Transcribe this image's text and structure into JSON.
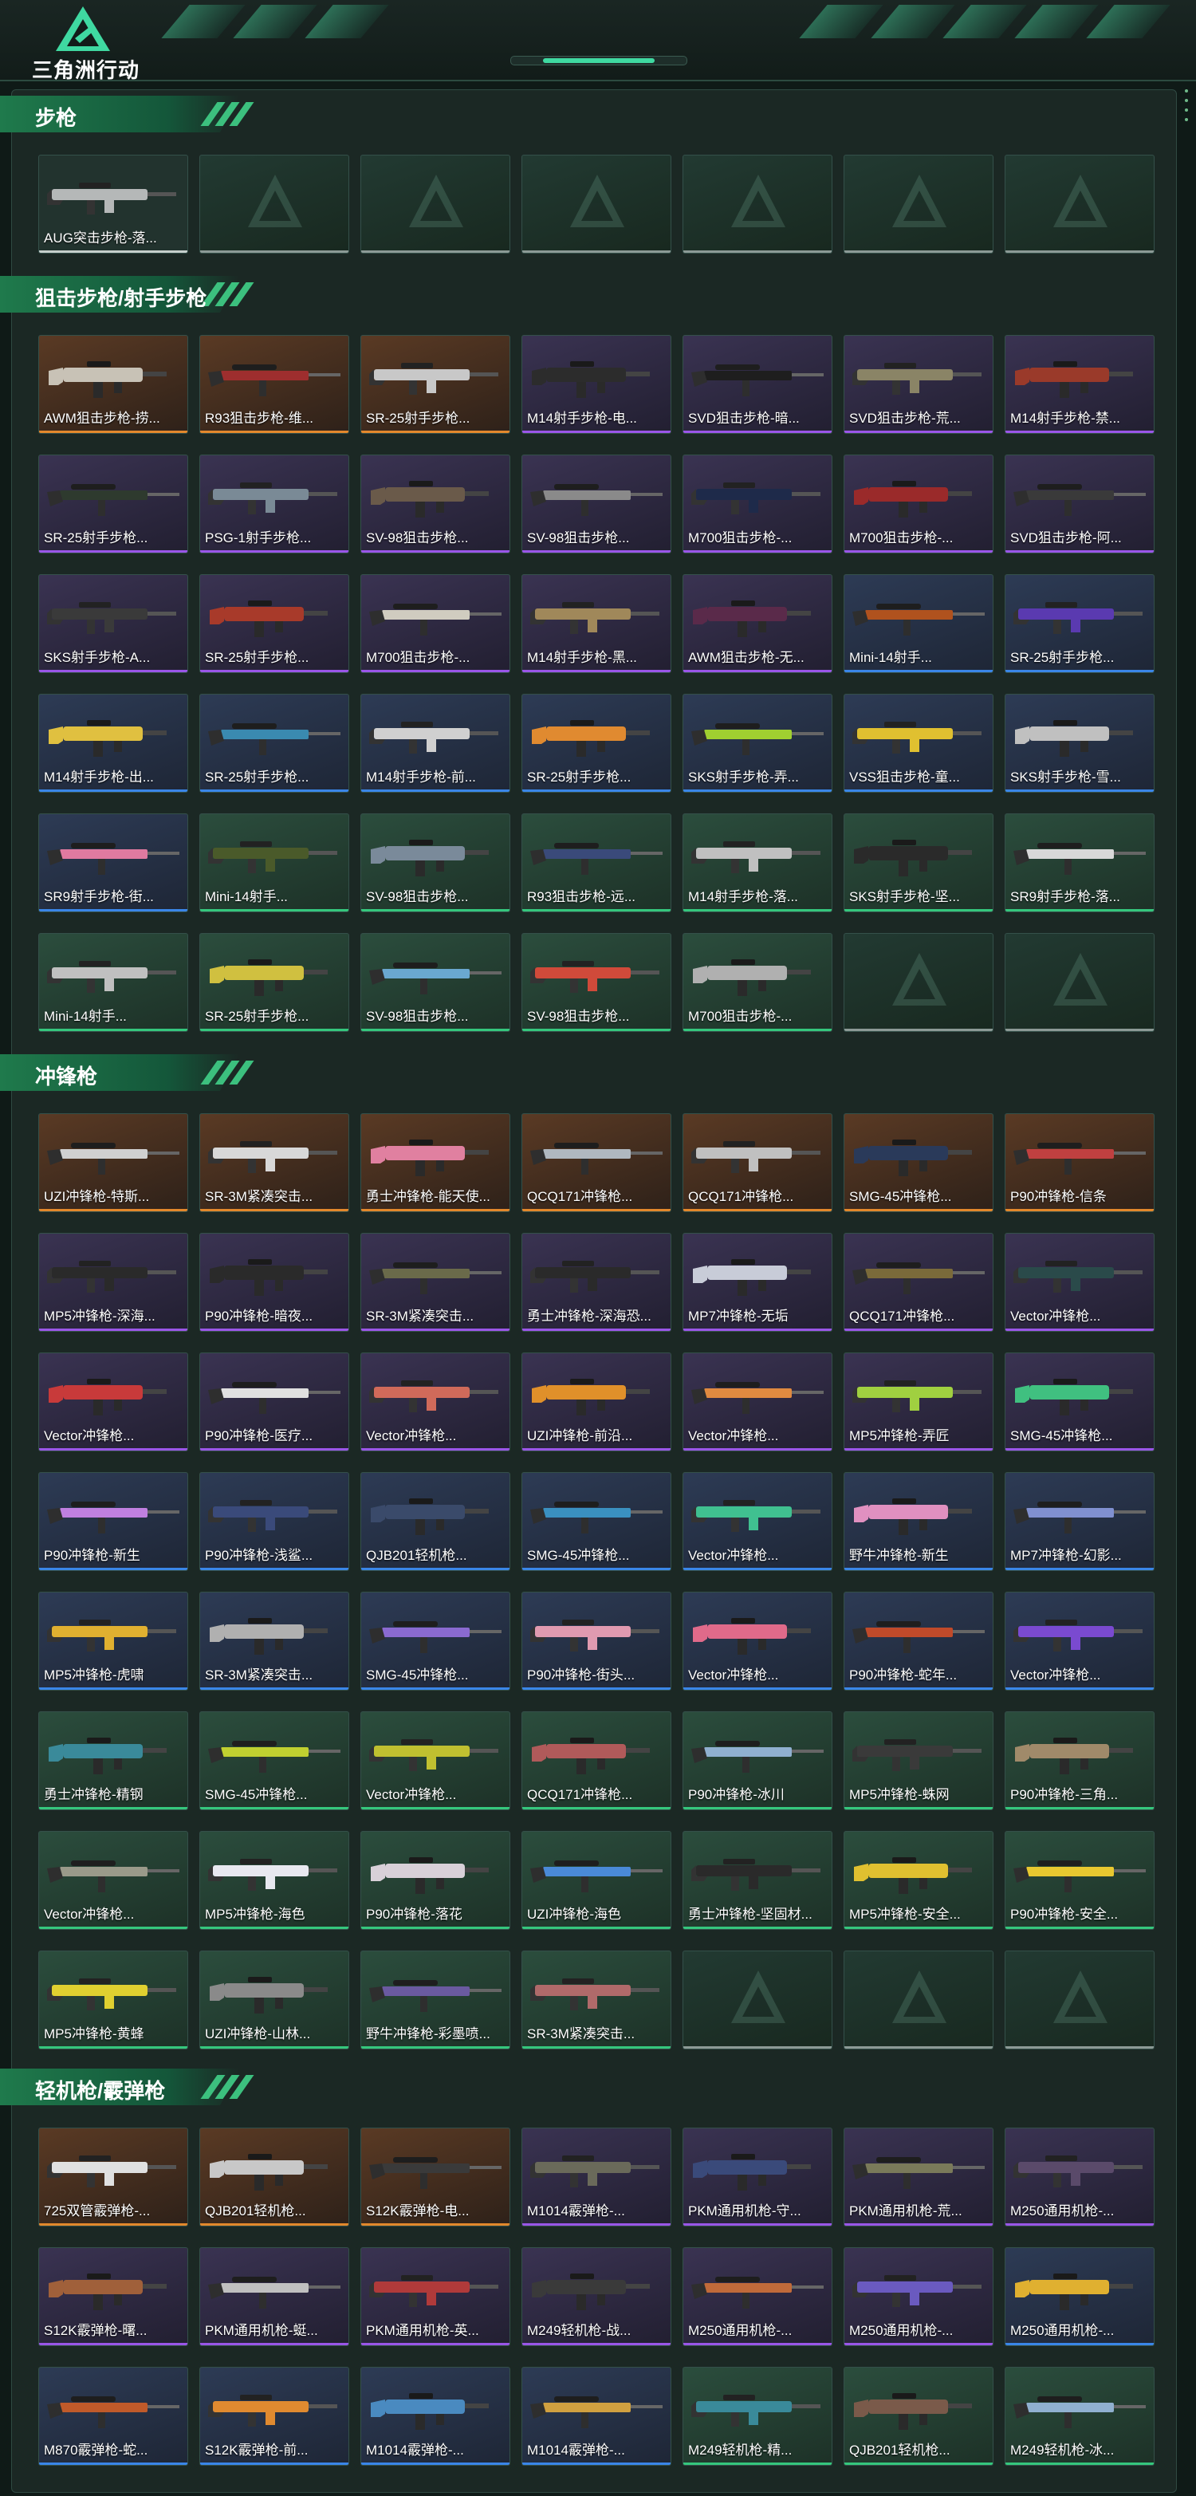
{
  "header": {
    "logo_text": "三角洲行动"
  },
  "colors": {
    "orange": "#e3882c",
    "purple": "#9a56e8",
    "blue": "#3a86e8",
    "green": "#35c77d",
    "gray": "#c6cfcc"
  },
  "sections": [
    {
      "title": "步枪",
      "items": [
        {
          "label": "AUG突击步枪-落...",
          "rarity": "gray",
          "color": "#b5b8b8"
        },
        {
          "label": "",
          "rarity": "empty"
        },
        {
          "label": "",
          "rarity": "empty"
        },
        {
          "label": "",
          "rarity": "empty"
        },
        {
          "label": "",
          "rarity": "empty"
        },
        {
          "label": "",
          "rarity": "empty"
        },
        {
          "label": "",
          "rarity": "empty"
        }
      ]
    },
    {
      "title": "狙击步枪/射手步枪",
      "items": [
        {
          "label": "AWM狙击步枪-捞...",
          "rarity": "orange",
          "color": "#c8c2b6"
        },
        {
          "label": "R93狙击步枪-维...",
          "rarity": "orange",
          "color": "#9e2e2e"
        },
        {
          "label": "SR-25射手步枪...",
          "rarity": "orange",
          "color": "#c8c8c8"
        },
        {
          "label": "M14射手步枪-电...",
          "rarity": "purple",
          "color": "#2c2c2c"
        },
        {
          "label": "SVD狙击步枪-暗...",
          "rarity": "purple",
          "color": "#1e1e1e"
        },
        {
          "label": "SVD狙击步枪-荒...",
          "rarity": "purple",
          "color": "#8a8466"
        },
        {
          "label": "M14射手步枪-禁...",
          "rarity": "purple",
          "color": "#9a3a2a"
        },
        {
          "label": "SR-25射手步枪...",
          "rarity": "purple",
          "color": "#2e3a2e"
        },
        {
          "label": "PSG-1射手步枪...",
          "rarity": "purple",
          "color": "#7a8a96"
        },
        {
          "label": "SV-98狙击步枪...",
          "rarity": "purple",
          "color": "#6a5a4a"
        },
        {
          "label": "SV-98狙击步枪...",
          "rarity": "purple",
          "color": "#8a8a8a"
        },
        {
          "label": "M700狙击步枪-...",
          "rarity": "purple",
          "color": "#1e2a4a"
        },
        {
          "label": "M700狙击步枪-...",
          "rarity": "purple",
          "color": "#9a2a2a"
        },
        {
          "label": "SVD狙击步枪-阿...",
          "rarity": "purple",
          "color": "#3a3a3a"
        },
        {
          "label": "SKS射手步枪-A...",
          "rarity": "purple",
          "color": "#3a3a3a"
        },
        {
          "label": "SR-25射手步枪...",
          "rarity": "purple",
          "color": "#a83a2a"
        },
        {
          "label": "M700狙击步枪-...",
          "rarity": "purple",
          "color": "#d0ccc0"
        },
        {
          "label": "M14射手步枪-黑...",
          "rarity": "purple",
          "color": "#a0885a"
        },
        {
          "label": "AWM狙击步枪-无...",
          "rarity": "purple",
          "color": "#5a2a4a"
        },
        {
          "label": "Mini-14射手...",
          "rarity": "blue",
          "color": "#b0521e"
        },
        {
          "label": "SR-25射手步枪...",
          "rarity": "blue",
          "color": "#5a3ab0"
        },
        {
          "label": "M14射手步枪-出...",
          "rarity": "blue",
          "color": "#e0c040"
        },
        {
          "label": "SR-25射手步枪...",
          "rarity": "blue",
          "color": "#3a8ab0"
        },
        {
          "label": "M14射手步枪-前...",
          "rarity": "blue",
          "color": "#d0d0d0"
        },
        {
          "label": "SR-25射手步枪...",
          "rarity": "blue",
          "color": "#e08a30"
        },
        {
          "label": "SKS射手步枪-弄...",
          "rarity": "blue",
          "color": "#a0d030"
        },
        {
          "label": "VSS狙击步枪-童...",
          "rarity": "blue",
          "color": "#e0c030"
        },
        {
          "label": "SKS射手步枪-雪...",
          "rarity": "blue",
          "color": "#c0c0c0"
        },
        {
          "label": "SR9射手步枪-街...",
          "rarity": "blue",
          "color": "#e07aa0"
        },
        {
          "label": "Mini-14射手...",
          "rarity": "green",
          "color": "#4a5a2a"
        },
        {
          "label": "SV-98狙击步枪...",
          "rarity": "green",
          "color": "#7a8a9a"
        },
        {
          "label": "R93狙击步枪-远...",
          "rarity": "green",
          "color": "#3a4a7a"
        },
        {
          "label": "M14射手步枪-落...",
          "rarity": "green",
          "color": "#c0c0c0"
        },
        {
          "label": "SKS射手步枪-坚...",
          "rarity": "green",
          "color": "#2a2a2a"
        },
        {
          "label": "SR9射手步枪-落...",
          "rarity": "green",
          "color": "#d8d8d8"
        },
        {
          "label": "Mini-14射手...",
          "rarity": "green",
          "color": "#c0c0c0"
        },
        {
          "label": "SR-25射手步枪...",
          "rarity": "green",
          "color": "#d0c040"
        },
        {
          "label": "SV-98狙击步枪...",
          "rarity": "green",
          "color": "#6aa8d0"
        },
        {
          "label": "SV-98狙击步枪...",
          "rarity": "green",
          "color": "#d04a3a"
        },
        {
          "label": "M700狙击步枪-...",
          "rarity": "green",
          "color": "#b0b0b0"
        },
        {
          "label": "",
          "rarity": "empty"
        },
        {
          "label": "",
          "rarity": "empty"
        }
      ]
    },
    {
      "title": "冲锋枪",
      "items": [
        {
          "label": "UZI冲锋枪-特斯...",
          "rarity": "orange",
          "color": "#d0d0d0"
        },
        {
          "label": "SR-3M紧凑突击...",
          "rarity": "orange",
          "color": "#d8d8d8"
        },
        {
          "label": "勇士冲锋枪-能天使...",
          "rarity": "orange",
          "color": "#e080a0"
        },
        {
          "label": "QCQ171冲锋枪...",
          "rarity": "orange",
          "color": "#b0b8c0"
        },
        {
          "label": "QCQ171冲锋枪...",
          "rarity": "orange",
          "color": "#c0c0c0"
        },
        {
          "label": "SMG-45冲锋枪...",
          "rarity": "orange",
          "color": "#2a3a5a"
        },
        {
          "label": "P90冲锋枪-信条",
          "rarity": "orange",
          "color": "#c04040"
        },
        {
          "label": "MP5冲锋枪-深海...",
          "rarity": "purple",
          "color": "#2a2a2a"
        },
        {
          "label": "P90冲锋枪-暗夜...",
          "rarity": "purple",
          "color": "#2a2a2a"
        },
        {
          "label": "SR-3M紧凑突击...",
          "rarity": "purple",
          "color": "#6a6a4a"
        },
        {
          "label": "勇士冲锋枪-深海恐...",
          "rarity": "purple",
          "color": "#2a2a2a"
        },
        {
          "label": "MP7冲锋枪-无垢",
          "rarity": "purple",
          "color": "#c8ccd8"
        },
        {
          "label": "QCQ171冲锋枪...",
          "rarity": "purple",
          "color": "#7a6a3a"
        },
        {
          "label": "Vector冲锋枪...",
          "rarity": "purple",
          "color": "#2a4a4a"
        },
        {
          "label": "Vector冲锋枪...",
          "rarity": "purple",
          "color": "#c83a3a"
        },
        {
          "label": "P90冲锋枪-医疗...",
          "rarity": "purple",
          "color": "#e0e0e0"
        },
        {
          "label": "Vector冲锋枪...",
          "rarity": "purple",
          "color": "#d06a5a"
        },
        {
          "label": "UZI冲锋枪-前沿...",
          "rarity": "purple",
          "color": "#e0902a"
        },
        {
          "label": "Vector冲锋枪...",
          "rarity": "purple",
          "color": "#e08a40"
        },
        {
          "label": "MP5冲锋枪-弄匠",
          "rarity": "purple",
          "color": "#a0d040"
        },
        {
          "label": "SMG-45冲锋枪...",
          "rarity": "purple",
          "color": "#40c080"
        },
        {
          "label": "P90冲锋枪-新生",
          "rarity": "blue",
          "color": "#c080e0"
        },
        {
          "label": "P90冲锋枪-浅鲨...",
          "rarity": "blue",
          "color": "#3a4a7a"
        },
        {
          "label": "QJB201轻机枪...",
          "rarity": "blue",
          "color": "#3a4a6a"
        },
        {
          "label": "SMG-45冲锋枪...",
          "rarity": "blue",
          "color": "#3a90c0"
        },
        {
          "label": "Vector冲锋枪...",
          "rarity": "blue",
          "color": "#40c090"
        },
        {
          "label": "野牛冲锋枪-新生",
          "rarity": "blue",
          "color": "#e090c0"
        },
        {
          "label": "MP7冲锋枪-幻影...",
          "rarity": "blue",
          "color": "#8090d0"
        },
        {
          "label": "MP5冲锋枪-虎啸",
          "rarity": "blue",
          "color": "#e0b030"
        },
        {
          "label": "SR-3M紧凑突击...",
          "rarity": "blue",
          "color": "#b0b0b0"
        },
        {
          "label": "SMG-45冲锋枪...",
          "rarity": "blue",
          "color": "#8a6ad0"
        },
        {
          "label": "P90冲锋枪-街头...",
          "rarity": "blue",
          "color": "#e09ab0"
        },
        {
          "label": "Vector冲锋枪...",
          "rarity": "blue",
          "color": "#e06a8a"
        },
        {
          "label": "P90冲锋枪-蛇年...",
          "rarity": "blue",
          "color": "#c04a2a"
        },
        {
          "label": "Vector冲锋枪...",
          "rarity": "blue",
          "color": "#7a4ad0"
        },
        {
          "label": "勇士冲锋枪-精钢",
          "rarity": "green",
          "color": "#3a8a9a"
        },
        {
          "label": "SMG-45冲锋枪...",
          "rarity": "green",
          "color": "#c0d030"
        },
        {
          "label": "Vector冲锋枪...",
          "rarity": "green",
          "color": "#c0c030"
        },
        {
          "label": "QCQ171冲锋枪...",
          "rarity": "green",
          "color": "#b05a5a"
        },
        {
          "label": "P90冲锋枪-冰川",
          "rarity": "green",
          "color": "#90b0d0"
        },
        {
          "label": "MP5冲锋枪-蛛网",
          "rarity": "green",
          "color": "#3a3a3a"
        },
        {
          "label": "P90冲锋枪-三角...",
          "rarity": "green",
          "color": "#a08a6a"
        },
        {
          "label": "Vector冲锋枪...",
          "rarity": "green",
          "color": "#9a9a8a"
        },
        {
          "label": "MP5冲锋枪-海色",
          "rarity": "green",
          "color": "#e8e8f0"
        },
        {
          "label": "P90冲锋枪-落花",
          "rarity": "green",
          "color": "#d8d0d8"
        },
        {
          "label": "UZI冲锋枪-海色",
          "rarity": "green",
          "color": "#4a8ad8"
        },
        {
          "label": "勇士冲锋枪-坚固材...",
          "rarity": "green",
          "color": "#2a2a2a"
        },
        {
          "label": "MP5冲锋枪-安全...",
          "rarity": "green",
          "color": "#e0c030"
        },
        {
          "label": "P90冲锋枪-安全...",
          "rarity": "green",
          "color": "#e8c830"
        },
        {
          "label": "MP5冲锋枪-黄蜂",
          "rarity": "green",
          "color": "#e0d030"
        },
        {
          "label": "UZI冲锋枪-山林...",
          "rarity": "green",
          "color": "#8a8a8a"
        },
        {
          "label": "野牛冲锋枪-彩墨喷...",
          "rarity": "green",
          "color": "#6a5aa0"
        },
        {
          "label": "SR-3M紧凑突击...",
          "rarity": "green",
          "color": "#b06a6a"
        },
        {
          "label": "",
          "rarity": "empty"
        },
        {
          "label": "",
          "rarity": "empty"
        },
        {
          "label": "",
          "rarity": "empty"
        }
      ]
    },
    {
      "title": "轻机枪/霰弹枪",
      "items": [
        {
          "label": "725双管霰弹枪-...",
          "rarity": "orange",
          "color": "#e0e0e0"
        },
        {
          "label": "QJB201轻机枪...",
          "rarity": "orange",
          "color": "#c8c8c8"
        },
        {
          "label": "S12K霰弹枪-电...",
          "rarity": "orange",
          "color": "#3a3a3a"
        },
        {
          "label": "M1014霰弹枪-...",
          "rarity": "purple",
          "color": "#6a6a5a"
        },
        {
          "label": "PKM通用机枪-守...",
          "rarity": "purple",
          "color": "#3a4a7a"
        },
        {
          "label": "PKM通用机枪-荒...",
          "rarity": "purple",
          "color": "#7a7a5a"
        },
        {
          "label": "M250通用机枪-...",
          "rarity": "purple",
          "color": "#5a4a6a"
        },
        {
          "label": "S12K霰弹枪-曙...",
          "rarity": "purple",
          "color": "#a0603a"
        },
        {
          "label": "PKM通用机枪-蜓...",
          "rarity": "purple",
          "color": "#c0c0c0"
        },
        {
          "label": "PKM通用机枪-英...",
          "rarity": "purple",
          "color": "#b03a3a"
        },
        {
          "label": "M249轻机枪-战...",
          "rarity": "purple",
          "color": "#3a3a3a"
        },
        {
          "label": "M250通用机枪-...",
          "rarity": "purple",
          "color": "#c06a3a"
        },
        {
          "label": "M250通用机枪-...",
          "rarity": "purple",
          "color": "#6a5ac0"
        },
        {
          "label": "M250通用机枪-...",
          "rarity": "blue",
          "color": "#e0b030"
        },
        {
          "label": "M870霰弹枪-蛇...",
          "rarity": "blue",
          "color": "#c05a2a"
        },
        {
          "label": "S12K霰弹枪-前...",
          "rarity": "blue",
          "color": "#e08a30"
        },
        {
          "label": "M1014霰弹枪-...",
          "rarity": "blue",
          "color": "#4a8ac0"
        },
        {
          "label": "M1014霰弹枪-...",
          "rarity": "blue",
          "color": "#d0a040"
        },
        {
          "label": "M249轻机枪-精...",
          "rarity": "green",
          "color": "#3a8a9a"
        },
        {
          "label": "QJB201轻机枪...",
          "rarity": "green",
          "color": "#7a5a4a"
        },
        {
          "label": "M249轻机枪-冰...",
          "rarity": "green",
          "color": "#90b0d0"
        }
      ]
    }
  ]
}
